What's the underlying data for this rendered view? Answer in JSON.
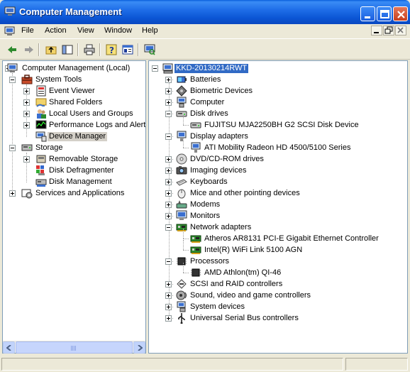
{
  "window": {
    "title": "Computer Management"
  },
  "menu": [
    "File",
    "Action",
    "View",
    "Window",
    "Help"
  ],
  "toolbar": {
    "icons": [
      "back-arrow-icon",
      "forward-arrow-icon",
      "up-folder-icon",
      "show-hide-console-tree-icon",
      "print-icon",
      "help-icon",
      "properties-icon",
      "scan-hardware-icon"
    ]
  },
  "left_tree": {
    "root": "Computer Management (Local)",
    "system_tools": "System Tools",
    "event_viewer": "Event Viewer",
    "shared_folders": "Shared Folders",
    "local_users": "Local Users and Groups",
    "perf_logs": "Performance Logs and Alerts",
    "device_manager": "Device Manager",
    "storage": "Storage",
    "removable_storage": "Removable Storage",
    "disk_defrag": "Disk Defragmenter",
    "disk_management": "Disk Management",
    "services": "Services and Applications"
  },
  "right_tree": {
    "computer_name": "KKD-20130214RWT",
    "items": [
      {
        "label": "Batteries",
        "icon": "battery-icon",
        "expanded": false,
        "children": []
      },
      {
        "label": "Biometric Devices",
        "icon": "biometric-icon",
        "expanded": false,
        "children": []
      },
      {
        "label": "Computer",
        "icon": "computer-icon",
        "expanded": false,
        "children": []
      },
      {
        "label": "Disk drives",
        "icon": "disk-drive-icon",
        "expanded": true,
        "children": [
          "FUJITSU MJA2250BH G2 SCSI Disk Device"
        ]
      },
      {
        "label": "Display adapters",
        "icon": "display-adapter-icon",
        "expanded": true,
        "children": [
          "ATI Mobility Radeon HD 4500/5100 Series"
        ]
      },
      {
        "label": "DVD/CD-ROM drives",
        "icon": "cdrom-icon",
        "expanded": false,
        "children": []
      },
      {
        "label": "Imaging devices",
        "icon": "camera-icon",
        "expanded": false,
        "children": []
      },
      {
        "label": "Keyboards",
        "icon": "keyboard-icon",
        "expanded": false,
        "children": []
      },
      {
        "label": "Mice and other pointing devices",
        "icon": "mouse-icon",
        "expanded": false,
        "children": []
      },
      {
        "label": "Modems",
        "icon": "modem-icon",
        "expanded": false,
        "children": []
      },
      {
        "label": "Monitors",
        "icon": "monitor-icon",
        "expanded": false,
        "children": []
      },
      {
        "label": "Network adapters",
        "icon": "network-card-icon",
        "expanded": true,
        "children": [
          "Atheros AR8131 PCI-E Gigabit Ethernet Controller",
          "Intel(R) WiFi Link 5100 AGN"
        ]
      },
      {
        "label": "Processors",
        "icon": "processor-icon",
        "expanded": true,
        "children": [
          "AMD Athlon(tm) QI-46"
        ]
      },
      {
        "label": "SCSI and RAID controllers",
        "icon": "scsi-icon",
        "expanded": false,
        "children": []
      },
      {
        "label": "Sound, video and game controllers",
        "icon": "sound-icon",
        "expanded": false,
        "children": []
      },
      {
        "label": "System devices",
        "icon": "system-device-icon",
        "expanded": false,
        "children": []
      },
      {
        "label": "Universal Serial Bus controllers",
        "icon": "usb-icon",
        "expanded": false,
        "children": []
      }
    ]
  },
  "colors": {
    "selection": "#316ac5",
    "titlebar": "#0b55d4"
  }
}
